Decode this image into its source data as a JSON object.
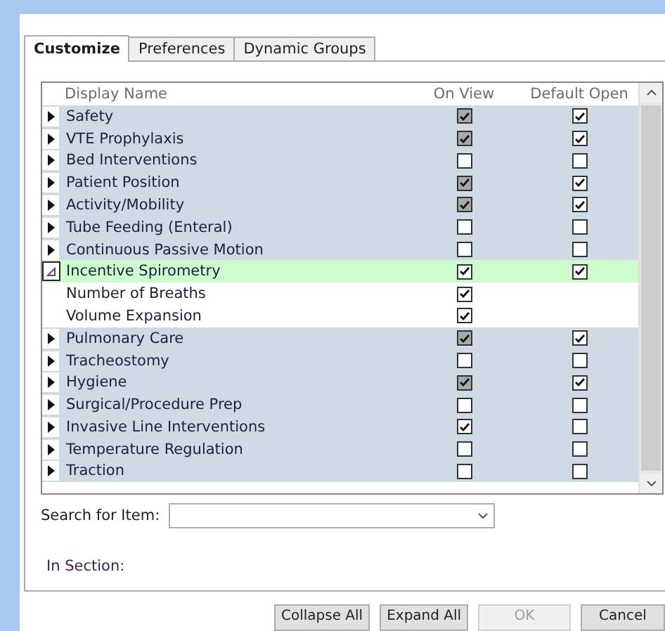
{
  "tabs": [
    {
      "label": "Customize",
      "selected": true
    },
    {
      "label": "Preferences",
      "selected": false
    },
    {
      "label": "Dynamic Groups",
      "selected": false
    }
  ],
  "table": {
    "columns": [
      "Display Name",
      "On View",
      "Default Open"
    ],
    "rows": [
      {
        "kind": "group",
        "name": "Safety",
        "expanded": false,
        "selected": false,
        "on_view": {
          "checked": true,
          "disabled": true
        },
        "default_open": {
          "checked": true,
          "disabled": false
        }
      },
      {
        "kind": "group",
        "name": "VTE Prophylaxis",
        "expanded": false,
        "selected": false,
        "on_view": {
          "checked": true,
          "disabled": true
        },
        "default_open": {
          "checked": true,
          "disabled": false
        }
      },
      {
        "kind": "group",
        "name": "Bed Interventions",
        "expanded": false,
        "selected": false,
        "on_view": {
          "checked": false,
          "disabled": false
        },
        "default_open": {
          "checked": false,
          "disabled": false
        }
      },
      {
        "kind": "group",
        "name": "Patient Position",
        "expanded": false,
        "selected": false,
        "on_view": {
          "checked": true,
          "disabled": true
        },
        "default_open": {
          "checked": true,
          "disabled": false
        }
      },
      {
        "kind": "group",
        "name": "Activity/Mobility",
        "expanded": false,
        "selected": false,
        "on_view": {
          "checked": true,
          "disabled": true
        },
        "default_open": {
          "checked": true,
          "disabled": false
        }
      },
      {
        "kind": "group",
        "name": "Tube Feeding (Enteral)",
        "expanded": false,
        "selected": false,
        "on_view": {
          "checked": false,
          "disabled": false
        },
        "default_open": {
          "checked": false,
          "disabled": false
        }
      },
      {
        "kind": "group",
        "name": "Continuous Passive Motion",
        "expanded": false,
        "selected": false,
        "on_view": {
          "checked": false,
          "disabled": false
        },
        "default_open": {
          "checked": false,
          "disabled": false
        }
      },
      {
        "kind": "group",
        "name": "Incentive Spirometry",
        "expanded": true,
        "selected": true,
        "on_view": {
          "checked": true,
          "disabled": false
        },
        "default_open": {
          "checked": true,
          "disabled": false
        }
      },
      {
        "kind": "child",
        "name": "Number of Breaths",
        "selected": false,
        "on_view": {
          "checked": true,
          "disabled": false
        }
      },
      {
        "kind": "child",
        "name": "Volume Expansion",
        "selected": false,
        "on_view": {
          "checked": true,
          "disabled": false
        }
      },
      {
        "kind": "group",
        "name": "Pulmonary Care",
        "expanded": false,
        "selected": false,
        "on_view": {
          "checked": true,
          "disabled": true
        },
        "default_open": {
          "checked": true,
          "disabled": false
        }
      },
      {
        "kind": "group",
        "name": "Tracheostomy",
        "expanded": false,
        "selected": false,
        "on_view": {
          "checked": false,
          "disabled": false
        },
        "default_open": {
          "checked": false,
          "disabled": false
        }
      },
      {
        "kind": "group",
        "name": "Hygiene",
        "expanded": false,
        "selected": false,
        "on_view": {
          "checked": true,
          "disabled": true
        },
        "default_open": {
          "checked": true,
          "disabled": false
        }
      },
      {
        "kind": "group",
        "name": "Surgical/Procedure Prep",
        "expanded": false,
        "selected": false,
        "on_view": {
          "checked": false,
          "disabled": false
        },
        "default_open": {
          "checked": false,
          "disabled": false
        }
      },
      {
        "kind": "group",
        "name": "Invasive Line Interventions",
        "expanded": false,
        "selected": false,
        "on_view": {
          "checked": true,
          "disabled": false
        },
        "default_open": {
          "checked": false,
          "disabled": false
        }
      },
      {
        "kind": "group",
        "name": "Temperature Regulation",
        "expanded": false,
        "selected": false,
        "on_view": {
          "checked": false,
          "disabled": false
        },
        "default_open": {
          "checked": false,
          "disabled": false
        }
      },
      {
        "kind": "group",
        "name": "Traction",
        "expanded": false,
        "selected": false,
        "on_view": {
          "checked": false,
          "disabled": false
        },
        "default_open": {
          "checked": false,
          "disabled": false
        }
      }
    ]
  },
  "search": {
    "label": "Search for Item:"
  },
  "in_section": {
    "label": "In Section:"
  },
  "buttons": [
    {
      "label": "Collapse All",
      "disabled": false
    },
    {
      "label": "Expand All",
      "disabled": false
    },
    {
      "label": "OK",
      "disabled": true
    },
    {
      "label": "Cancel",
      "disabled": false
    }
  ]
}
